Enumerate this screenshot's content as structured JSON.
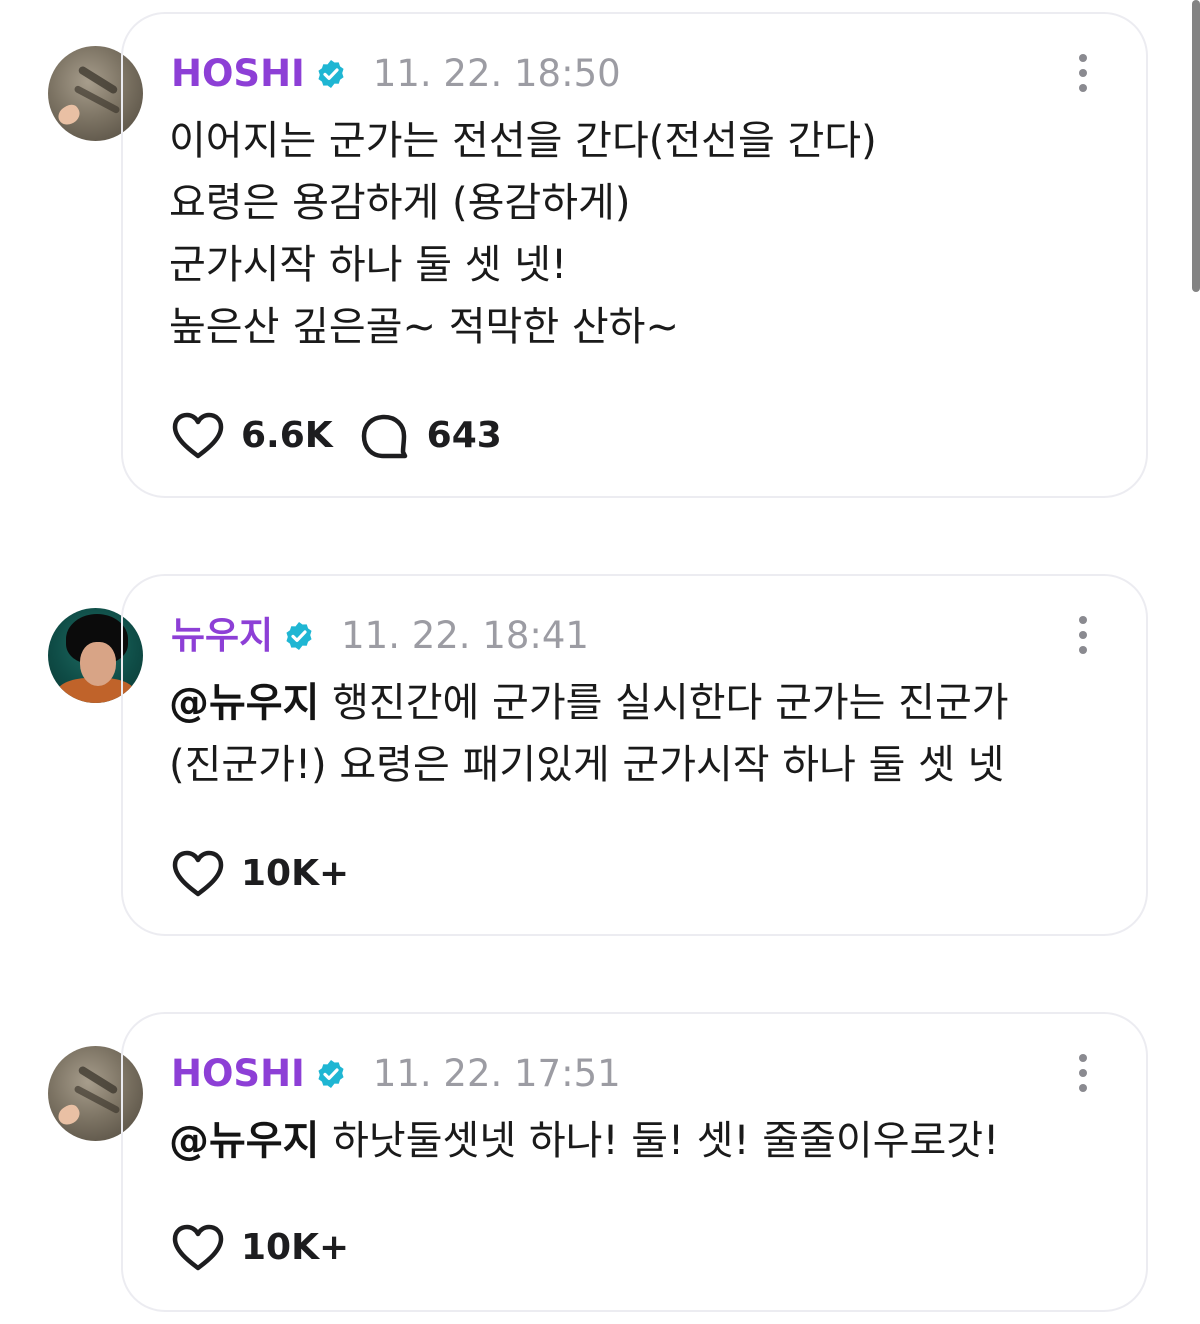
{
  "posts": [
    {
      "username": "HOSHI",
      "verified": true,
      "timestamp": "11. 22. 18:50",
      "avatar": "hoshi-avatar",
      "mention": "",
      "lines": [
        "이어지는 군가는 전선을 간다(전선을 간다)",
        "요령은 용감하게 (용감하게)",
        "군가시작 하나 둘 셋 넷!",
        "높은산 깊은골~ 적막한 산하~"
      ],
      "likes": "6.6K",
      "replies": "643"
    },
    {
      "username": "뉴우지",
      "verified": true,
      "timestamp": "11. 22. 18:41",
      "avatar": "wooji-avatar",
      "mention": "@뉴우지",
      "lines": [
        "행진간에 군가를 실시한다 군가는 진군가",
        "(진군가!) 요령은 패기있게 군가시작 하나 둘 셋 넷"
      ],
      "likes": "10K+",
      "replies": ""
    },
    {
      "username": "HOSHI",
      "verified": true,
      "timestamp": "11. 22. 17:51",
      "avatar": "hoshi-avatar",
      "mention": "@뉴우지",
      "lines": [
        "하낫둘셋넷 하나! 둘! 셋! 줄줄이우로갓!"
      ],
      "likes": "10K+",
      "replies": ""
    }
  ],
  "colors": {
    "username": "#8d3fd6",
    "verified_badge": "#1fb6d3",
    "timestamp": "#9c9ca3",
    "card_border": "#ececf1"
  },
  "icons": {
    "like": "heart-icon",
    "reply": "speech-bubble-icon",
    "more": "more-vertical-icon",
    "verified": "verified-badge-icon"
  }
}
